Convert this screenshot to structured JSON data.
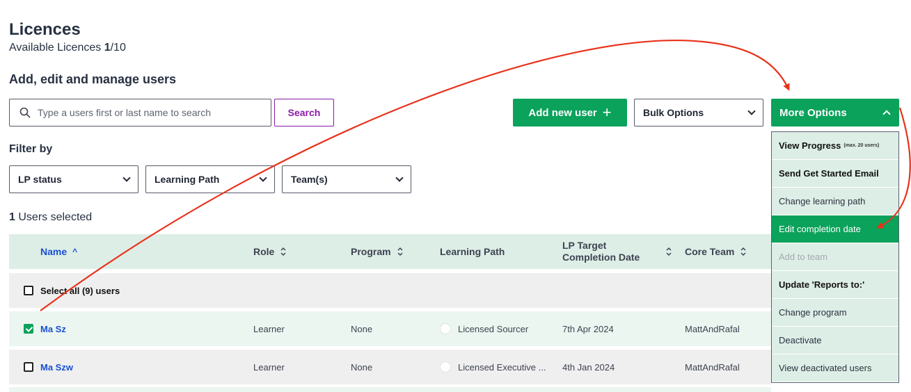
{
  "page": {
    "title": "Licences",
    "available_label": "Available Licences",
    "available_used": "1",
    "available_total": "/10",
    "section_title": "Add, edit and manage users"
  },
  "search": {
    "placeholder": "Type a users first or last name to search",
    "button": "Search"
  },
  "actions": {
    "add_user": "Add new user",
    "add_user_icon": "plus-icon",
    "bulk_options": "Bulk Options",
    "more_options": "More Options"
  },
  "filters": {
    "label": "Filter by",
    "lp_status": "LP status",
    "learning_path": "Learning Path",
    "teams": "Team(s)"
  },
  "selection": {
    "count": "1",
    "label": "Users selected"
  },
  "table": {
    "headers": {
      "name": "Name",
      "role": "Role",
      "program": "Program",
      "learning_path": "Learning Path",
      "lp_target": "LP Target Completion Date",
      "core_team": "Core Team"
    },
    "select_all": "Select all (9) users",
    "rows": [
      {
        "name": "Ma Sz",
        "role": "Learner",
        "program": "None",
        "learning_path": "Licensed Sourcer",
        "target_date": "7th Apr 2024",
        "core_team": "MattAndRafal",
        "checked": true
      },
      {
        "name": "Ma Szw",
        "role": "Learner",
        "program": "None",
        "learning_path": "Licensed Executive ...",
        "target_date": "4th Jan 2024",
        "core_team": "MattAndRafal",
        "checked": false
      }
    ]
  },
  "menu": {
    "items": [
      {
        "label": "View Progress",
        "note": "(max. 20 users)"
      },
      {
        "label": "Send Get Started Email"
      },
      {
        "label": "Change learning path"
      },
      {
        "label": "Edit completion date"
      },
      {
        "label": "Add to team"
      },
      {
        "label": "Update 'Reports to:'"
      },
      {
        "label": "Change program"
      },
      {
        "label": "Deactivate"
      },
      {
        "label": "View deactivated users"
      }
    ]
  },
  "colors": {
    "primary_green": "#0ba25b",
    "link_blue": "#1850d4",
    "search_purple": "#8a1aa6",
    "annotation_red": "#e8321b"
  }
}
